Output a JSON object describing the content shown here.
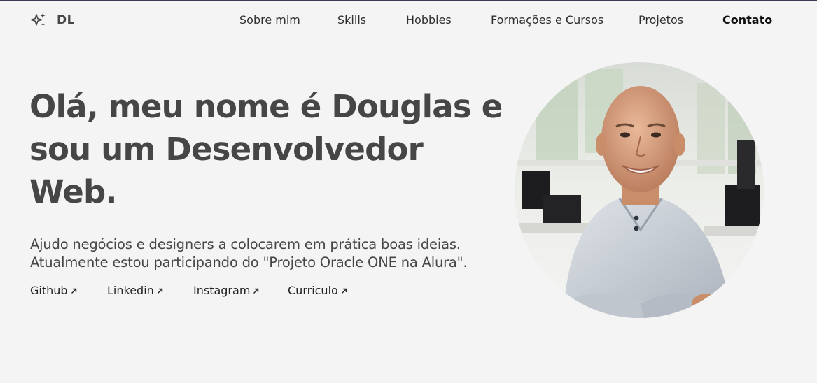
{
  "header": {
    "logo_text": "DL",
    "logo_icon": "sparkles-icon",
    "nav": [
      {
        "label": "Sobre mim",
        "active": false
      },
      {
        "label": "Skills",
        "active": false
      },
      {
        "label": "Hobbies",
        "active": false
      },
      {
        "label": "Formações e Cursos",
        "active": false
      },
      {
        "label": "Projetos",
        "active": false
      },
      {
        "label": "Contato",
        "active": true
      }
    ]
  },
  "hero": {
    "title": "Olá, meu nome é Douglas e sou um Desenvolvedor Web.",
    "description_line1": "Ajudo negócios e designers a colocarem em prática boas ideias.",
    "description_line2": "Atualmente estou participando do \"Projeto Oracle ONE na Alura\".",
    "links": [
      {
        "label": "Github",
        "icon": "arrow-up-right-icon"
      },
      {
        "label": "Linkedin",
        "icon": "arrow-up-right-icon"
      },
      {
        "label": "Instagram",
        "icon": "arrow-up-right-icon"
      },
      {
        "label": "Curriculo",
        "icon": "arrow-up-right-icon"
      }
    ]
  },
  "colors": {
    "background": "#f4f4f4",
    "text": "#464646",
    "top_border": "#3c3a55"
  }
}
